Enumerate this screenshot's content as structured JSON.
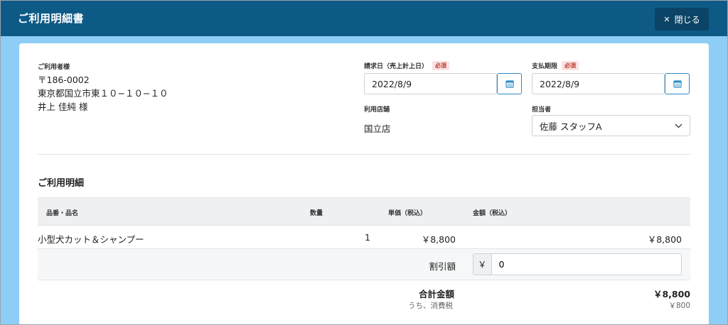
{
  "header": {
    "title": "ご利用明細書",
    "close_label": "閉じる",
    "close_icon": "close-icon"
  },
  "customer": {
    "label": "ご利用者様",
    "postal": "〒186-0002",
    "address": "東京都国立市東１０−１０−１０",
    "name": "井上 佳純 様"
  },
  "billing_date": {
    "label": "請求日（売上計上日）",
    "required_badge": "必須",
    "value": "2022/8/9"
  },
  "payment_due": {
    "label": "支払期限",
    "required_badge": "必須",
    "value": "2022/8/9"
  },
  "store": {
    "label": "利用店舗",
    "value": "国立店"
  },
  "staff": {
    "label": "担当者",
    "selected": "佐藤 スタッフA"
  },
  "details": {
    "title": "ご利用明細",
    "columns": [
      "品番・品名",
      "数量",
      "単価（税込）",
      "金額（税込）"
    ],
    "items": [
      {
        "name": "小型犬カット＆シャンプー",
        "qty": "1",
        "unit_price": "￥8,800",
        "amount": "￥8,800"
      }
    ],
    "discount": {
      "label": "割引額",
      "currency": "￥",
      "value": "0"
    },
    "total_label": "合計金額",
    "total_value": "￥8,800",
    "tax_label": "うち、消費税",
    "tax_value": "￥800"
  },
  "colors": {
    "header_bg": "#0e5a86",
    "page_bg": "#8ecdf5",
    "accent": "#2b88c6",
    "required": "#c0392b"
  }
}
